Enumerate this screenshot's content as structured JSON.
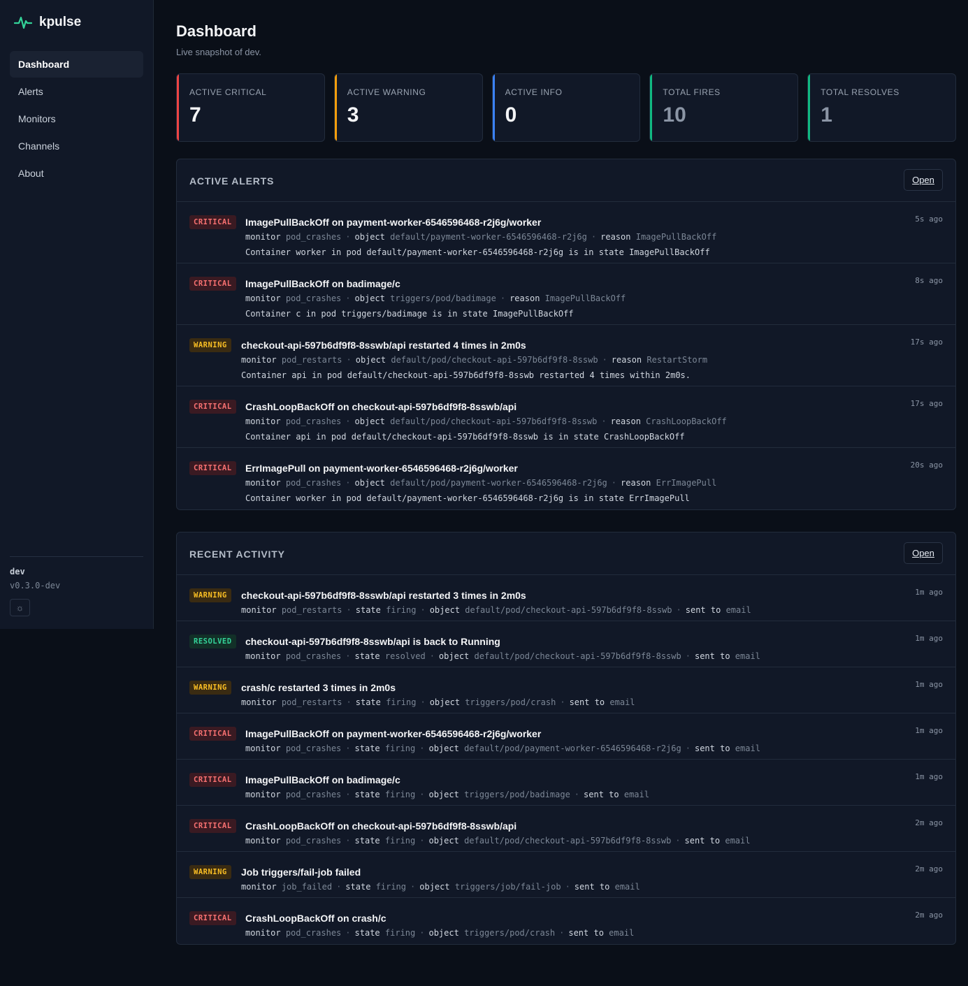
{
  "brand": {
    "name": "kpulse",
    "accent": "#34d399"
  },
  "nav": [
    {
      "label": "Dashboard",
      "active": true
    },
    {
      "label": "Alerts",
      "active": false
    },
    {
      "label": "Monitors",
      "active": false
    },
    {
      "label": "Channels",
      "active": false
    },
    {
      "label": "About",
      "active": false
    }
  ],
  "sidebar_footer": {
    "env": "dev",
    "version": "v0.3.0-dev",
    "theme_icon": "sun-icon"
  },
  "page": {
    "title": "Dashboard",
    "subtitle": "Live snapshot of dev."
  },
  "stats": [
    {
      "label": "ACTIVE CRITICAL",
      "value": "7",
      "color": "#ef4444"
    },
    {
      "label": "ACTIVE WARNING",
      "value": "3",
      "color": "#f59e0b"
    },
    {
      "label": "ACTIVE INFO",
      "value": "0",
      "color": "#3b82f6"
    },
    {
      "label": "TOTAL FIRES",
      "value": "10",
      "color": "#10b981"
    },
    {
      "label": "TOTAL RESOLVES",
      "value": "1",
      "color": "#10b981"
    }
  ],
  "active_alerts": {
    "title": "ACTIVE ALERTS",
    "open_label": "Open",
    "rows": [
      {
        "severity": "CRITICAL",
        "title": "ImagePullBackOff on payment-worker-6546596468-r2j6g/worker",
        "meta": [
          {
            "k": "monitor",
            "v": "pod_crashes"
          },
          {
            "k": "object",
            "v": "default/payment-worker-6546596468-r2j6g"
          },
          {
            "k": "reason",
            "v": "ImagePullBackOff"
          }
        ],
        "detail": "Container worker in pod default/payment-worker-6546596468-r2j6g is in state ImagePullBackOff",
        "time": "5s ago"
      },
      {
        "severity": "CRITICAL",
        "title": "ImagePullBackOff on badimage/c",
        "meta": [
          {
            "k": "monitor",
            "v": "pod_crashes"
          },
          {
            "k": "object",
            "v": "triggers/pod/badimage"
          },
          {
            "k": "reason",
            "v": "ImagePullBackOff"
          }
        ],
        "detail": "Container c in pod triggers/badimage is in state ImagePullBackOff",
        "time": "8s ago"
      },
      {
        "severity": "WARNING",
        "title": "checkout-api-597b6df9f8-8sswb/api restarted 4 times in 2m0s",
        "meta": [
          {
            "k": "monitor",
            "v": "pod_restarts"
          },
          {
            "k": "object",
            "v": "default/pod/checkout-api-597b6df9f8-8sswb"
          },
          {
            "k": "reason",
            "v": "RestartStorm"
          }
        ],
        "detail": "Container api in pod default/checkout-api-597b6df9f8-8sswb restarted 4 times within 2m0s.",
        "time": "17s ago"
      },
      {
        "severity": "CRITICAL",
        "title": "CrashLoopBackOff on checkout-api-597b6df9f8-8sswb/api",
        "meta": [
          {
            "k": "monitor",
            "v": "pod_crashes"
          },
          {
            "k": "object",
            "v": "default/pod/checkout-api-597b6df9f8-8sswb"
          },
          {
            "k": "reason",
            "v": "CrashLoopBackOff"
          }
        ],
        "detail": "Container api in pod default/checkout-api-597b6df9f8-8sswb is in state CrashLoopBackOff",
        "time": "17s ago"
      },
      {
        "severity": "CRITICAL",
        "title": "ErrImagePull on payment-worker-6546596468-r2j6g/worker",
        "meta": [
          {
            "k": "monitor",
            "v": "pod_crashes"
          },
          {
            "k": "object",
            "v": "default/pod/payment-worker-6546596468-r2j6g"
          },
          {
            "k": "reason",
            "v": "ErrImagePull"
          }
        ],
        "detail": "Container worker in pod default/payment-worker-6546596468-r2j6g is in state ErrImagePull",
        "time": "20s ago"
      }
    ]
  },
  "recent_activity": {
    "title": "RECENT ACTIVITY",
    "open_label": "Open",
    "rows": [
      {
        "severity": "WARNING",
        "title": "checkout-api-597b6df9f8-8sswb/api restarted 3 times in 2m0s",
        "meta": [
          {
            "k": "monitor",
            "v": "pod_restarts"
          },
          {
            "k": "state",
            "v": "firing"
          },
          {
            "k": "object",
            "v": "default/pod/checkout-api-597b6df9f8-8sswb"
          },
          {
            "k": "sent to",
            "v": "email"
          }
        ],
        "time": "1m ago"
      },
      {
        "severity": "RESOLVED",
        "title": "checkout-api-597b6df9f8-8sswb/api is back to Running",
        "meta": [
          {
            "k": "monitor",
            "v": "pod_crashes"
          },
          {
            "k": "state",
            "v": "resolved"
          },
          {
            "k": "object",
            "v": "default/pod/checkout-api-597b6df9f8-8sswb"
          },
          {
            "k": "sent to",
            "v": "email"
          }
        ],
        "time": "1m ago"
      },
      {
        "severity": "WARNING",
        "title": "crash/c restarted 3 times in 2m0s",
        "meta": [
          {
            "k": "monitor",
            "v": "pod_restarts"
          },
          {
            "k": "state",
            "v": "firing"
          },
          {
            "k": "object",
            "v": "triggers/pod/crash"
          },
          {
            "k": "sent to",
            "v": "email"
          }
        ],
        "time": "1m ago"
      },
      {
        "severity": "CRITICAL",
        "title": "ImagePullBackOff on payment-worker-6546596468-r2j6g/worker",
        "meta": [
          {
            "k": "monitor",
            "v": "pod_crashes"
          },
          {
            "k": "state",
            "v": "firing"
          },
          {
            "k": "object",
            "v": "default/pod/payment-worker-6546596468-r2j6g"
          },
          {
            "k": "sent to",
            "v": "email"
          }
        ],
        "time": "1m ago"
      },
      {
        "severity": "CRITICAL",
        "title": "ImagePullBackOff on badimage/c",
        "meta": [
          {
            "k": "monitor",
            "v": "pod_crashes"
          },
          {
            "k": "state",
            "v": "firing"
          },
          {
            "k": "object",
            "v": "triggers/pod/badimage"
          },
          {
            "k": "sent to",
            "v": "email"
          }
        ],
        "time": "1m ago"
      },
      {
        "severity": "CRITICAL",
        "title": "CrashLoopBackOff on checkout-api-597b6df9f8-8sswb/api",
        "meta": [
          {
            "k": "monitor",
            "v": "pod_crashes"
          },
          {
            "k": "state",
            "v": "firing"
          },
          {
            "k": "object",
            "v": "default/pod/checkout-api-597b6df9f8-8sswb"
          },
          {
            "k": "sent to",
            "v": "email"
          }
        ],
        "time": "2m ago"
      },
      {
        "severity": "WARNING",
        "title": "Job triggers/fail-job failed",
        "meta": [
          {
            "k": "monitor",
            "v": "job_failed"
          },
          {
            "k": "state",
            "v": "firing"
          },
          {
            "k": "object",
            "v": "triggers/job/fail-job"
          },
          {
            "k": "sent to",
            "v": "email"
          }
        ],
        "time": "2m ago"
      },
      {
        "severity": "CRITICAL",
        "title": "CrashLoopBackOff on crash/c",
        "meta": [
          {
            "k": "monitor",
            "v": "pod_crashes"
          },
          {
            "k": "state",
            "v": "firing"
          },
          {
            "k": "object",
            "v": "triggers/pod/crash"
          },
          {
            "k": "sent to",
            "v": "email"
          }
        ],
        "time": "2m ago"
      }
    ]
  }
}
